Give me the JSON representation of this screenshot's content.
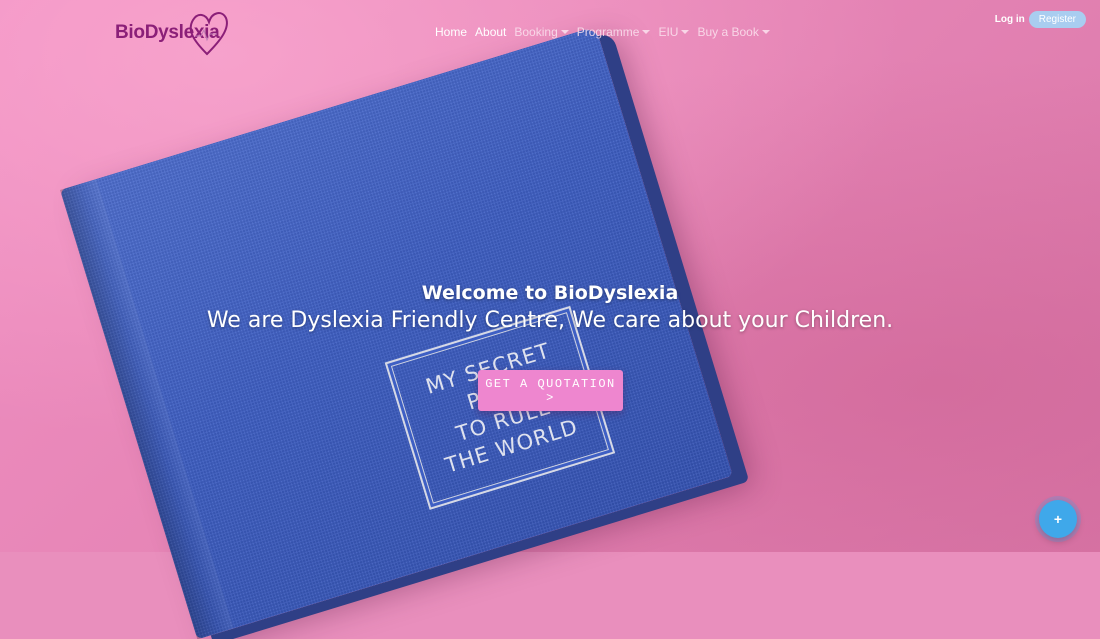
{
  "brand": {
    "name": "BioDyslexia",
    "logo_icon": "heart-icon",
    "accent": "#8b1f78"
  },
  "nav": {
    "items": [
      {
        "label": "Home",
        "dropdown": false
      },
      {
        "label": "About",
        "dropdown": false
      },
      {
        "label": "Booking",
        "dropdown": true
      },
      {
        "label": "Programme",
        "dropdown": true
      },
      {
        "label": "EIU",
        "dropdown": true
      },
      {
        "label": "Buy a Book",
        "dropdown": true
      }
    ]
  },
  "auth": {
    "login": "Log in",
    "register": "Register"
  },
  "hero": {
    "welcome": "Welcome to BioDyslexia",
    "tagline": "We are Dyslexia Friendly Centre, We care about your Children.",
    "cta": "GET A QUOTATION >",
    "book_lines": [
      "MY SECRET",
      "PLAN",
      "TO RULE",
      "THE WORLD"
    ]
  },
  "fab": {
    "label": "+",
    "icon": "plus-icon"
  },
  "colors": {
    "background": "#e98fbd",
    "cta": "#ee86cf",
    "fab": "#3fa8ea",
    "register": "#a9cdf0"
  }
}
